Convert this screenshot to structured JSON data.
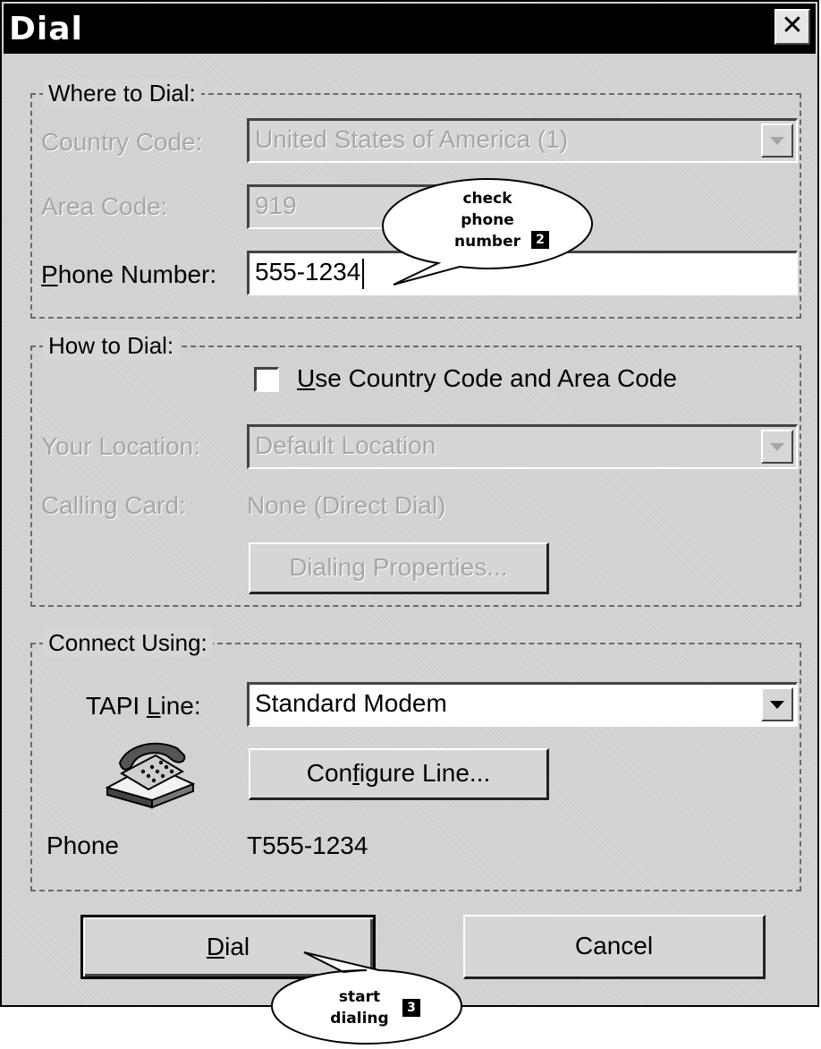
{
  "title": "Dial",
  "close_glyph": "✕",
  "where": {
    "heading": "Where to Dial:",
    "country_code_label": "Country Code:",
    "country_code_value": "United States of America (1)",
    "area_code_label": "Area Code:",
    "area_code_value": "919",
    "phone_label": "Phone Number:",
    "phone_value": "555-1234"
  },
  "how": {
    "heading": "How to Dial:",
    "use_codes_label": "Use Country Code and Area Code",
    "use_codes_checked": false,
    "location_label": "Your Location:",
    "location_value": "Default Location",
    "calling_card_label": "Calling Card:",
    "calling_card_value": "None (Direct Dial)",
    "dialing_props_label": "Dialing Properties..."
  },
  "connect": {
    "heading": "Connect Using:",
    "tapi_label": "TAPI Line:",
    "tapi_value": "Standard Modem",
    "configure_label": "Configure Line...",
    "phone_label": "Phone",
    "phone_value": "T555-1234"
  },
  "buttons": {
    "dial": "Dial",
    "cancel": "Cancel"
  },
  "callouts": [
    {
      "lines": [
        "check",
        "phone",
        "number"
      ],
      "badge": "2"
    },
    {
      "lines": [
        "start",
        "dialing"
      ],
      "badge": "3"
    }
  ]
}
